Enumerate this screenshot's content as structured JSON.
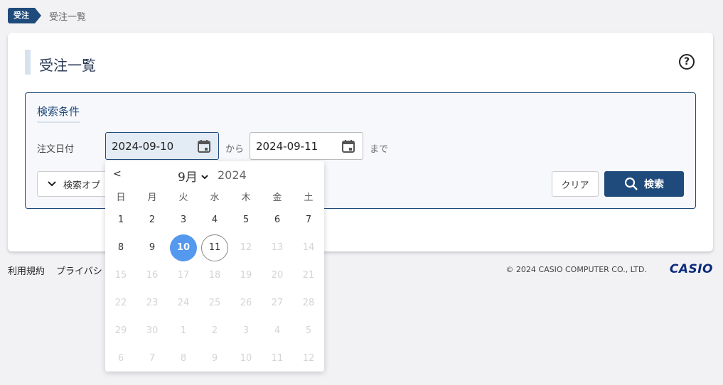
{
  "breadcrumb": {
    "tag": "受注",
    "current": "受注一覧"
  },
  "page": {
    "title": "受注一覧",
    "help_glyph": "?"
  },
  "search": {
    "title": "検索条件",
    "date_label": "注文日付",
    "date_from": "2024-09-10",
    "date_from_sep": "から",
    "date_to": "2024-09-11",
    "date_to_sep": "まで",
    "options_toggle": "検索オプ",
    "clear_button": "クリア",
    "search_button": "検索"
  },
  "footer": {
    "links": [
      "利用規約",
      "プライバシ"
    ],
    "copyright": "© 2024 CASIO COMPUTER CO., LTD.",
    "logo": "CASIO"
  },
  "calendar": {
    "prev": "<",
    "month": "9月",
    "year": "2024",
    "weekdays": [
      "日",
      "月",
      "火",
      "水",
      "木",
      "金",
      "土"
    ],
    "weeks": [
      [
        "1",
        "2",
        "3",
        "4",
        "5",
        "6",
        "7"
      ],
      [
        "8",
        "9",
        "10",
        "11",
        "12",
        "13",
        "14"
      ],
      [
        "15",
        "16",
        "17",
        "18",
        "19",
        "20",
        "21"
      ],
      [
        "22",
        "23",
        "24",
        "25",
        "26",
        "27",
        "28"
      ],
      [
        "29",
        "30",
        "1",
        "2",
        "3",
        "4",
        "5"
      ],
      [
        "6",
        "7",
        "8",
        "9",
        "10",
        "11",
        "12"
      ]
    ],
    "selected_day": "10",
    "today_day": "11",
    "enabled_through": "11"
  },
  "colors": {
    "primary": "#1f4a7c",
    "selected": "#5599ee",
    "accent_bar": "#d6e2ee",
    "dim_text": "#d4d4d8"
  }
}
